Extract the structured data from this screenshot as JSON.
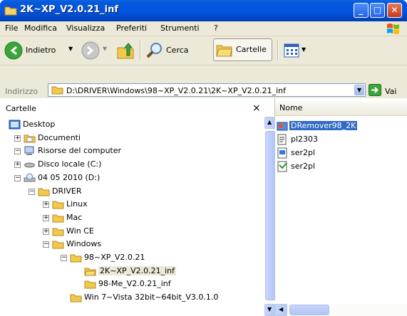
{
  "window": {
    "title": "2K~XP_V2.0.21_inf"
  },
  "menu": [
    "File",
    "Modifica",
    "Visualizza",
    "Preferiti",
    "Strumenti",
    "?"
  ],
  "toolbar": {
    "back": "Indietro",
    "search": "Cerca",
    "folders": "Cartelle"
  },
  "address": {
    "label": "Indirizzo",
    "path": "D:\\DRIVER\\Windows\\98~XP_V2.0.21\\2K~XP_V2.0.21_inf",
    "go": "Vai"
  },
  "left_pane": {
    "title": "Cartelle",
    "close": "×",
    "tree": [
      {
        "label": "Desktop",
        "level": 0,
        "icon": "desktop-icon",
        "expander": ""
      },
      {
        "label": "Documenti",
        "level": 1,
        "icon": "documents-folder-icon",
        "expander": "+"
      },
      {
        "label": "Risorse del computer",
        "level": 1,
        "icon": "my-computer-icon",
        "expander": "-"
      },
      {
        "label": "Disco locale (C:)",
        "level": 2,
        "icon": "hard-drive-icon",
        "expander": "+"
      },
      {
        "label": "04 05 2010 (D:)",
        "level": 2,
        "icon": "cd-drive-icon",
        "expander": "-"
      },
      {
        "label": "DRIVER",
        "level": 3,
        "icon": "folder-icon",
        "expander": "-"
      },
      {
        "label": "Linux",
        "level": 4,
        "icon": "folder-icon",
        "expander": "+"
      },
      {
        "label": "Mac",
        "level": 4,
        "icon": "folder-icon",
        "expander": "+"
      },
      {
        "label": "Win CE",
        "level": 4,
        "icon": "folder-icon",
        "expander": "+"
      },
      {
        "label": "Windows",
        "level": 4,
        "icon": "folder-icon",
        "expander": "-"
      },
      {
        "label": "98~XP_V2.0.21",
        "level": 5,
        "icon": "folder-icon",
        "expander": "-"
      },
      {
        "label": "2K~XP_V2.0.21_inf",
        "level": 6,
        "icon": "open-folder-icon",
        "expander": "",
        "selected": true
      },
      {
        "label": "98-Me_V2.0.21_inf",
        "level": 6,
        "icon": "folder-icon",
        "expander": ""
      },
      {
        "label": "Win 7~Vista 32bit~64bit_V3.0.1.0",
        "level": 5,
        "icon": "folder-icon",
        "expander": ""
      }
    ]
  },
  "right_pane": {
    "column": "Nome",
    "files": [
      {
        "name": "DRemover98_2K",
        "icon": "installer-icon",
        "selected": true
      },
      {
        "name": "pl2303",
        "icon": "setup-info-icon"
      },
      {
        "name": "ser2pl",
        "icon": "system-file-icon"
      },
      {
        "name": "ser2pl",
        "icon": "catalog-icon"
      }
    ]
  },
  "colors": {
    "titlebar": "#0355e0",
    "selection": "#316ac5",
    "chrome": "#ece9d8"
  }
}
